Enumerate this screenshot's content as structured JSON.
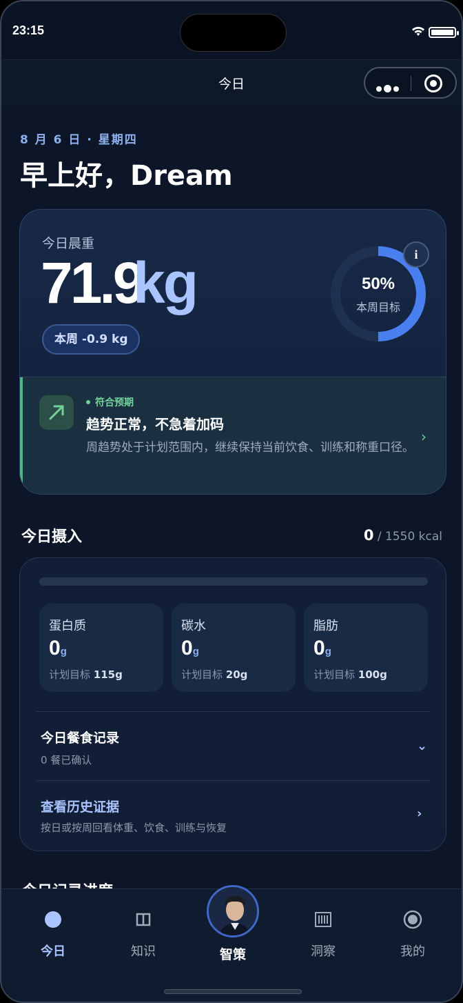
{
  "status": {
    "time": "23:15"
  },
  "nav": {
    "title": "今日"
  },
  "header": {
    "date": "8 月 6 日 · 星期四",
    "greeting": "早上好，Dream"
  },
  "weight": {
    "label": "今日晨重",
    "value": "71.9",
    "unit": "kg",
    "week_change": "本周 -0.9 kg",
    "goal_progress": 0.5,
    "goal_percent": "50%",
    "goal_label": "本周目标",
    "info": "i"
  },
  "trend": {
    "badge": "符合预期",
    "title": "趋势正常，不急着加码",
    "desc": "周趋势处于计划范围内，继续保持当前饮食、训练和称重口径。",
    "chevron": "›"
  },
  "intake": {
    "title": "今日摄入",
    "consumed": "0",
    "target": "/ 1550 kcal",
    "progress": 0,
    "macros": [
      {
        "name": "蛋白质",
        "value": "0",
        "unit": "g",
        "target_label": "计划目标",
        "target": "115g"
      },
      {
        "name": "碳水",
        "value": "0",
        "unit": "g",
        "target_label": "计划目标",
        "target": "20g"
      },
      {
        "name": "脂肪",
        "value": "0",
        "unit": "g",
        "target_label": "计划目标",
        "target": "100g"
      }
    ],
    "meals": {
      "title": "今日餐食记录",
      "sub": "0 餐已确认",
      "chevron": "⌄"
    },
    "history": {
      "title": "查看历史证据",
      "sub": "按日或按周回看体重、饮食、训练与恢复",
      "chevron": "›"
    }
  },
  "peek": {
    "title": "今日记录进度"
  },
  "tabs": [
    {
      "label": "今日",
      "icon": "circle-icon"
    },
    {
      "label": "知识",
      "icon": "book-icon"
    },
    {
      "label": "智策",
      "icon": "avatar"
    },
    {
      "label": "洞察",
      "icon": "barcode-icon"
    },
    {
      "label": "我的",
      "icon": "target-icon"
    }
  ],
  "colors": {
    "accent": "#4a7ff0",
    "success": "#6fd39a",
    "bg": "#0c1628"
  }
}
